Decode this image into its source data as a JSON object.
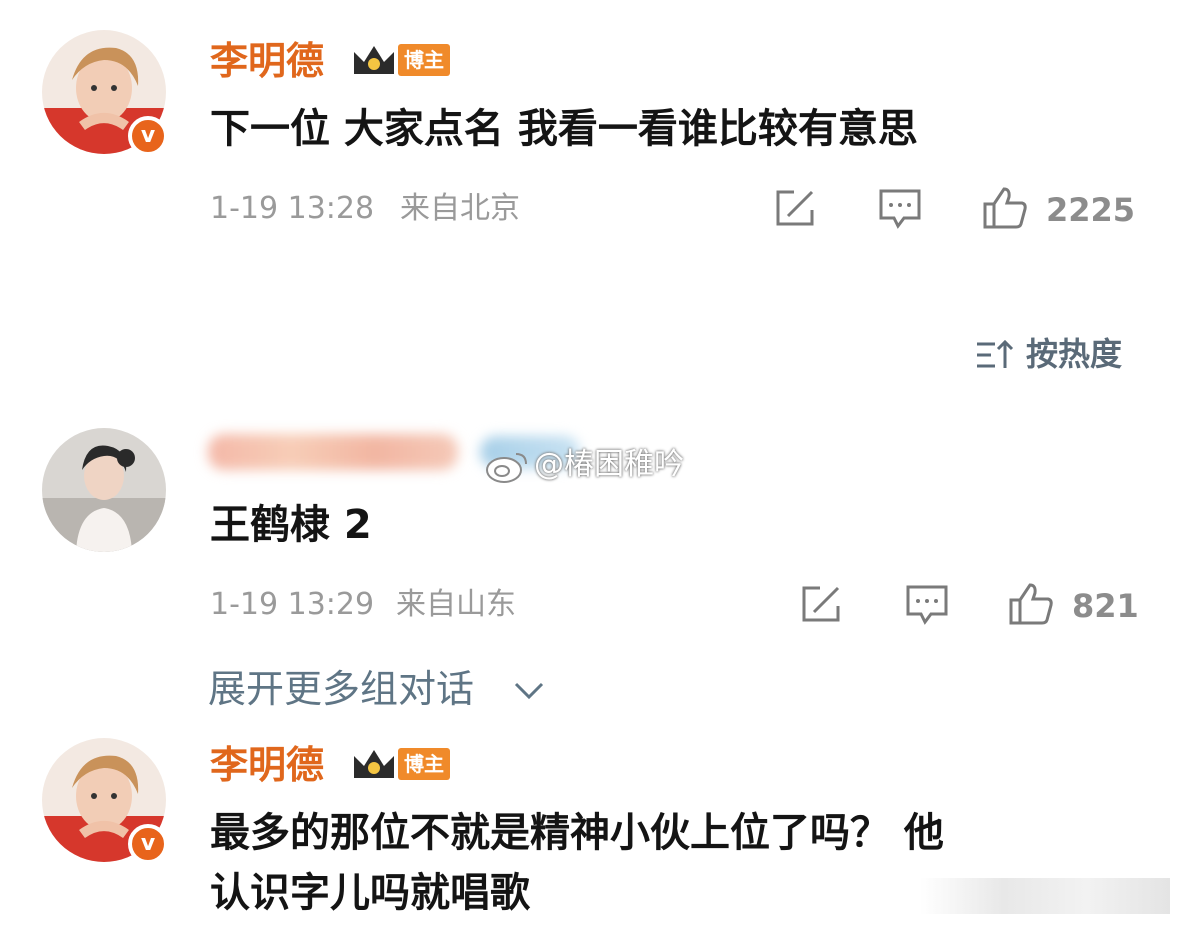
{
  "post_reply": {
    "author": "李明德",
    "badge": "博主",
    "text": "下一位 大家点名 我看一看谁比较有意思",
    "time": "1-19 13:28",
    "location": "来自北京",
    "likes": "2225"
  },
  "sort": {
    "label": "按热度"
  },
  "reply": {
    "text": "王鹤棣 2",
    "time": "1-19 13:29",
    "location": "来自山东",
    "likes": "821"
  },
  "watermark": {
    "text": "@椿困稚吟"
  },
  "expand": {
    "label": "展开更多组对话"
  },
  "latest_reply": {
    "author": "李明德",
    "badge": "博主",
    "text_line1": "最多的那位不就是精神小伙上位了吗？ 他",
    "text_line2": "认识字儿吗就唱歌"
  },
  "colors": {
    "author_orange": "#e0671c",
    "verified_orange": "#e8641b",
    "meta_gray": "#9a9a9a",
    "link_blue_gray": "#5f7585"
  },
  "icons": [
    "verified-icon",
    "crown-icon",
    "share-icon",
    "comment-icon",
    "like-icon",
    "sort-icon",
    "chevron-down-icon",
    "weibo-logo-icon"
  ]
}
